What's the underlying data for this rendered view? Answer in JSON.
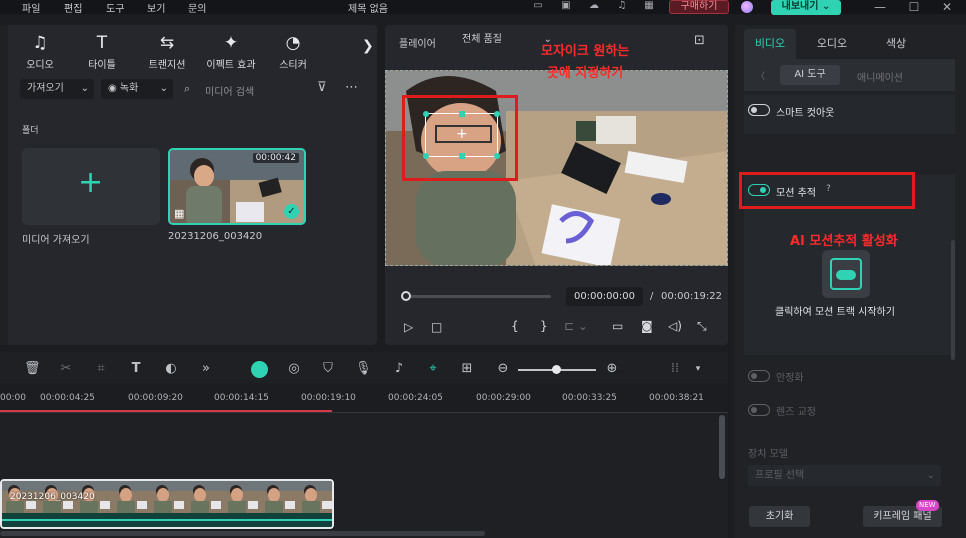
{
  "menubar": {
    "items": [
      "파일",
      "편집",
      "도구",
      "보기",
      "문의"
    ],
    "title": "제목 없음",
    "buy_label": "구매하기",
    "export_label": "내보내기"
  },
  "library": {
    "tools": [
      {
        "icon": "audio-icon",
        "label": "오디오"
      },
      {
        "icon": "title-icon",
        "label": "타이틀"
      },
      {
        "icon": "transition-icon",
        "label": "트랜지션"
      },
      {
        "icon": "effects-icon",
        "label": "이펙트 효과"
      },
      {
        "icon": "sticker-icon",
        "label": "스티커"
      }
    ],
    "import_dropdown": "가져오기",
    "record_dropdown": "녹화",
    "search_placeholder": "미디어 검색",
    "folder_label": "폴더",
    "import_card_label": "미디어 가져오기",
    "clip_name": "20231206_003420",
    "clip_duration": "00:00:42"
  },
  "player": {
    "label": "플레이어",
    "quality": "전체 품질",
    "current_time": "00:00:00:00",
    "separator": "/",
    "total_time": "00:00:19:22"
  },
  "annotations": {
    "mosaic_line1": "모자이크 원하는",
    "mosaic_line2": "곳에 지정하기",
    "ai_motion": "AI 모션추적 활성화"
  },
  "right_panel": {
    "tabs": [
      "비디오",
      "오디오",
      "색상"
    ],
    "subtabs": [
      "AI 도구",
      "애니메이션"
    ],
    "smart_cutout": "스마트 컷아웃",
    "motion_tracking": "모션 추적",
    "track_start": "클릭하여 모션 트랙 시작하기",
    "stabilization": "안정화",
    "lens_correction": "렌즈 교정",
    "device_model_label": "장치 모델",
    "profile_select": "프로필 선택",
    "reset_label": "초기화",
    "keyframe_label": "키프레임 패널",
    "new_badge": "NEW"
  },
  "timeline": {
    "ruler": [
      "00:00",
      "00:00:04:25",
      "00:00:09:20",
      "00:00:14:15",
      "00:00:19:10",
      "00:00:24:05",
      "00:00:29:00",
      "00:00:33:25",
      "00:00:38:21"
    ],
    "clip_label": "20231206_003420"
  }
}
